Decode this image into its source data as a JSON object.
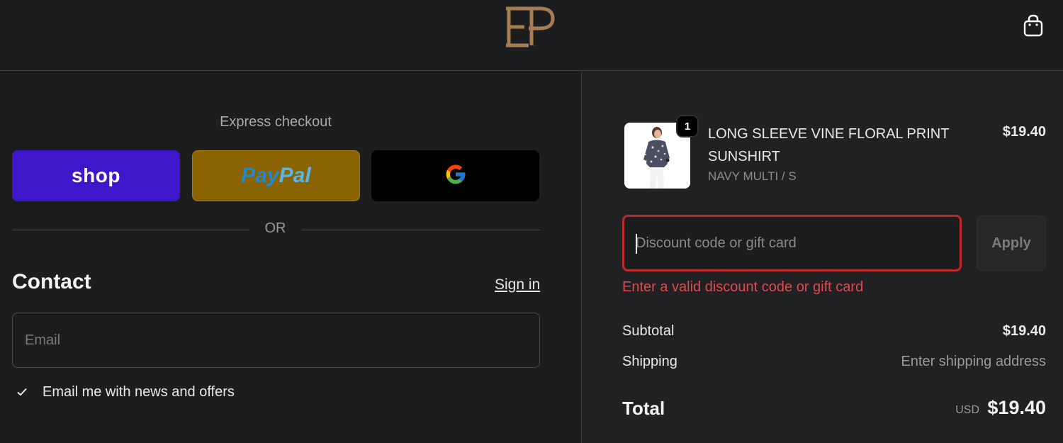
{
  "header": {
    "logo_text": "EP",
    "cart_icon": "shopping-bag-icon"
  },
  "express": {
    "label": "Express checkout",
    "shop_label": "shop",
    "paypal_label_pay": "Pay",
    "paypal_label_pal": "Pal",
    "gpay_icon": "google-g-icon"
  },
  "divider_or": "OR",
  "contact": {
    "title": "Contact",
    "signin": "Sign in",
    "email_placeholder": "Email",
    "email_value": "",
    "newsletter_checked": true,
    "newsletter_label": "Email me with news and offers"
  },
  "order": {
    "item": {
      "quantity": "1",
      "name": "LONG SLEEVE VINE FLORAL PRINT SUNSHIRT",
      "variant": "NAVY MULTI / S",
      "price": "$19.40"
    },
    "discount": {
      "placeholder": "Discount code or gift card",
      "value": "",
      "apply_label": "Apply",
      "error": "Enter a valid discount code or gift card"
    },
    "subtotal_label": "Subtotal",
    "subtotal_value": "$19.40",
    "shipping_label": "Shipping",
    "shipping_value": "Enter shipping address",
    "total_label": "Total",
    "total_currency": "USD",
    "total_value": "$19.40"
  },
  "colors": {
    "background": "#1c1d1f",
    "summary_background": "#202123",
    "shop_pay": "#3d17c9",
    "paypal": "#8a6302",
    "error": "#e04a4f",
    "logo": "#a67c52"
  }
}
